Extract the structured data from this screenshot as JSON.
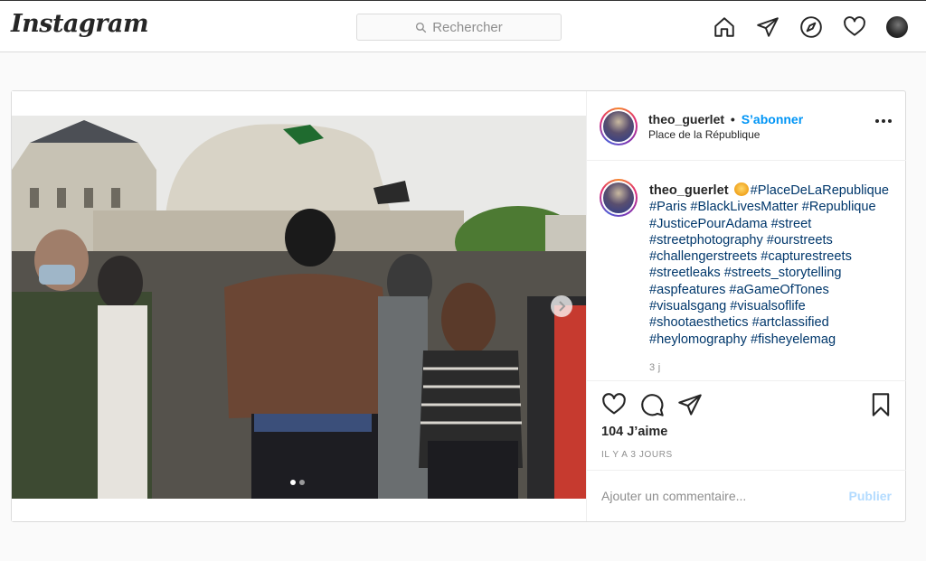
{
  "nav": {
    "logo": "Instagram",
    "search_placeholder": "Rechercher"
  },
  "post": {
    "username": "theo_guerlet",
    "separator": "•",
    "follow_label": "S’abonner",
    "location": "Place de la République",
    "caption_user": "theo_guerlet",
    "caption_lines": [
      "#PlaceDeLaRepublique",
      "#Paris #BlackLivesMatter #Republique",
      "#JusticePourAdama #street",
      "#streetphotography #ourstreets",
      "#challengerstreets #capturestreets",
      "#streetleaks #streets_storytelling",
      "#aspfeatures #aGameOfTones",
      "#visualsgang #visualsoflife",
      "#shootaesthetics #artclassified",
      "#heylomography #fisheyelemag"
    ],
    "age": "3 j",
    "likes": "104 J’aime",
    "posted_when": "IL Y A 3 JOURS",
    "comment_placeholder": "Ajouter un commentaire...",
    "publish_label": "Publier",
    "carousel_total": 2,
    "carousel_index": 1
  },
  "colors": {
    "link": "#00376b",
    "follow": "#0095f6",
    "publish_disabled": "#b3dbff"
  }
}
